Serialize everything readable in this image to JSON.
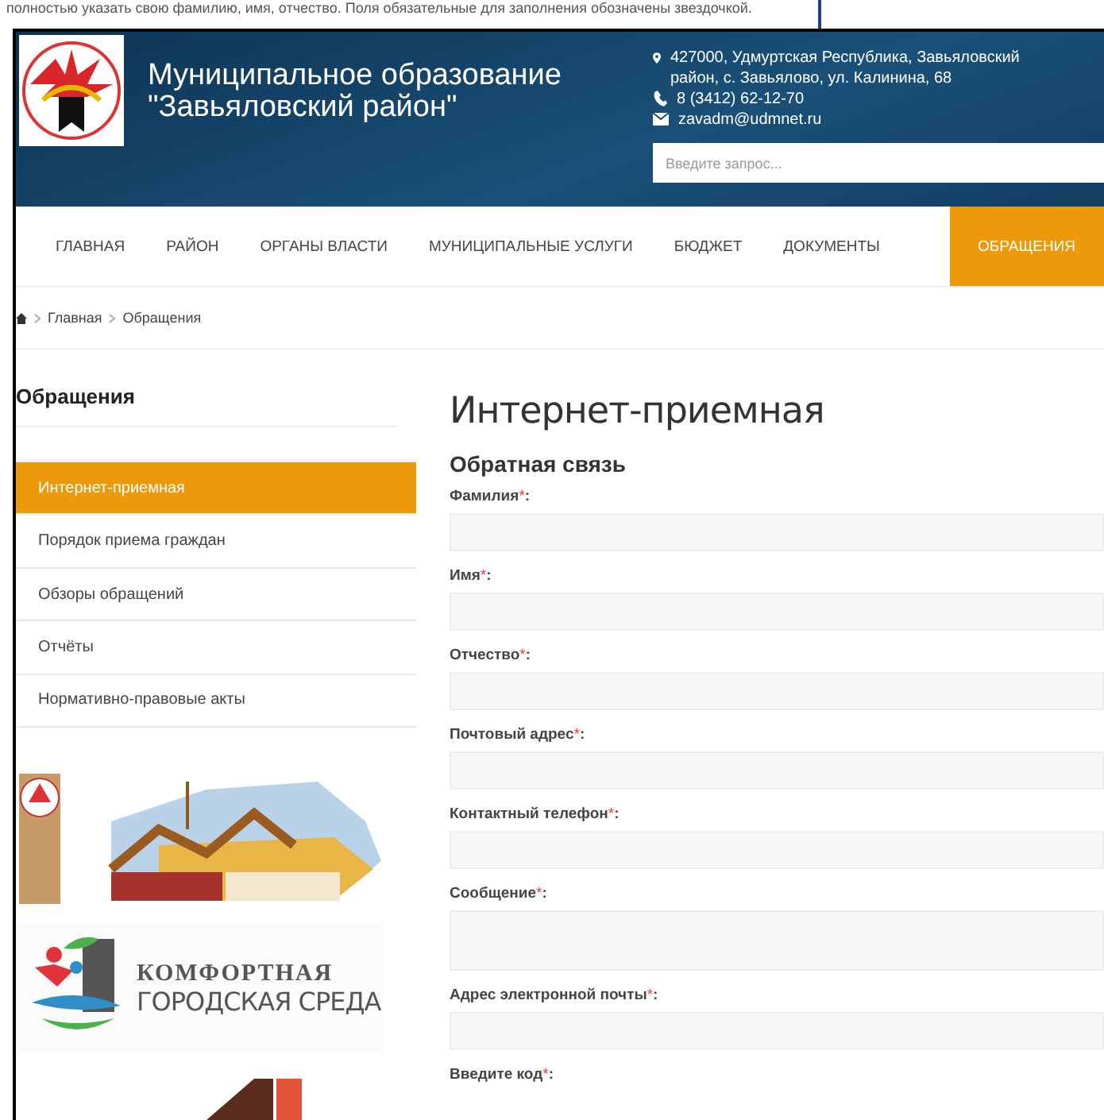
{
  "background_page": {
    "text": "полностью указать свою фамилию, имя, отчество. Поля обязательные для заполнения обозначены звездочкой."
  },
  "header": {
    "title_lines": [
      "Муниципальное образование",
      "\"Завьяловский район\""
    ],
    "contacts": [
      {
        "kind": "address",
        "text": "427000, Удмуртская Республика, Завьяловский район, с. Завьялово, ул. Калинина, 68"
      },
      {
        "kind": "phone",
        "text": "8 (3412) 62-12-70"
      },
      {
        "kind": "email",
        "text": "zavadm@udmnet.ru"
      }
    ],
    "search": {
      "placeholder": "Введите запрос..."
    }
  },
  "nav": [
    {
      "label": "ГЛАВНАЯ",
      "selected": false
    },
    {
      "label": "РАЙОН",
      "selected": false
    },
    {
      "label": "ОРГАНЫ ВЛАСТИ",
      "selected": false
    },
    {
      "label": "МУНИЦИПАЛЬНЫЕ УСЛУГИ",
      "selected": false
    },
    {
      "label": "БЮДЖЕТ",
      "selected": false
    },
    {
      "label": "ДОКУМЕНТЫ",
      "selected": false
    },
    {
      "label": "ОБРАЩЕНИЯ",
      "selected": true
    }
  ],
  "breadcrumb": [
    "Главная",
    "Обращения"
  ],
  "sidebar": {
    "title": "Обращения",
    "items": [
      {
        "label": "Интернет-приемная",
        "selected": true
      },
      {
        "label": "Порядок приема граждан",
        "selected": false
      },
      {
        "label": "Обзоры обращений",
        "selected": false
      },
      {
        "label": "Отчёты",
        "selected": false
      },
      {
        "label": "Нормативно-правовые акты",
        "selected": false
      }
    ],
    "banners": [
      {
        "kind": "picture"
      },
      {
        "kind": "comfort",
        "lines": [
          "КОМФОРТНАЯ",
          "ГОРОДСКАЯ СРЕДА"
        ]
      },
      {
        "kind": "partial"
      }
    ]
  },
  "main": {
    "title": "Интернет-приемная",
    "subtitle": "Обратная связь",
    "fields": [
      {
        "label": "Фамилия",
        "asterisk": "*",
        "colon": ":",
        "kind": "input"
      },
      {
        "label": "Имя",
        "asterisk": "*",
        "colon": ":",
        "kind": "input"
      },
      {
        "label": "Отчество",
        "asterisk": "*",
        "colon": ":",
        "kind": "input"
      },
      {
        "label": "Почтовый адрес",
        "asterisk": "*",
        "colon": ":",
        "kind": "input"
      },
      {
        "label": "Контактный телефон",
        "asterisk": "*",
        "colon": ":",
        "kind": "input"
      },
      {
        "label": "Сообщение",
        "asterisk": "*",
        "colon": ":",
        "kind": "textarea"
      },
      {
        "label": "Адрес электронной почты",
        "asterisk": "*",
        "colon": ":",
        "kind": "input"
      },
      {
        "label": "Введите код",
        "asterisk": "*",
        "colon": ":",
        "kind": "none"
      }
    ]
  }
}
